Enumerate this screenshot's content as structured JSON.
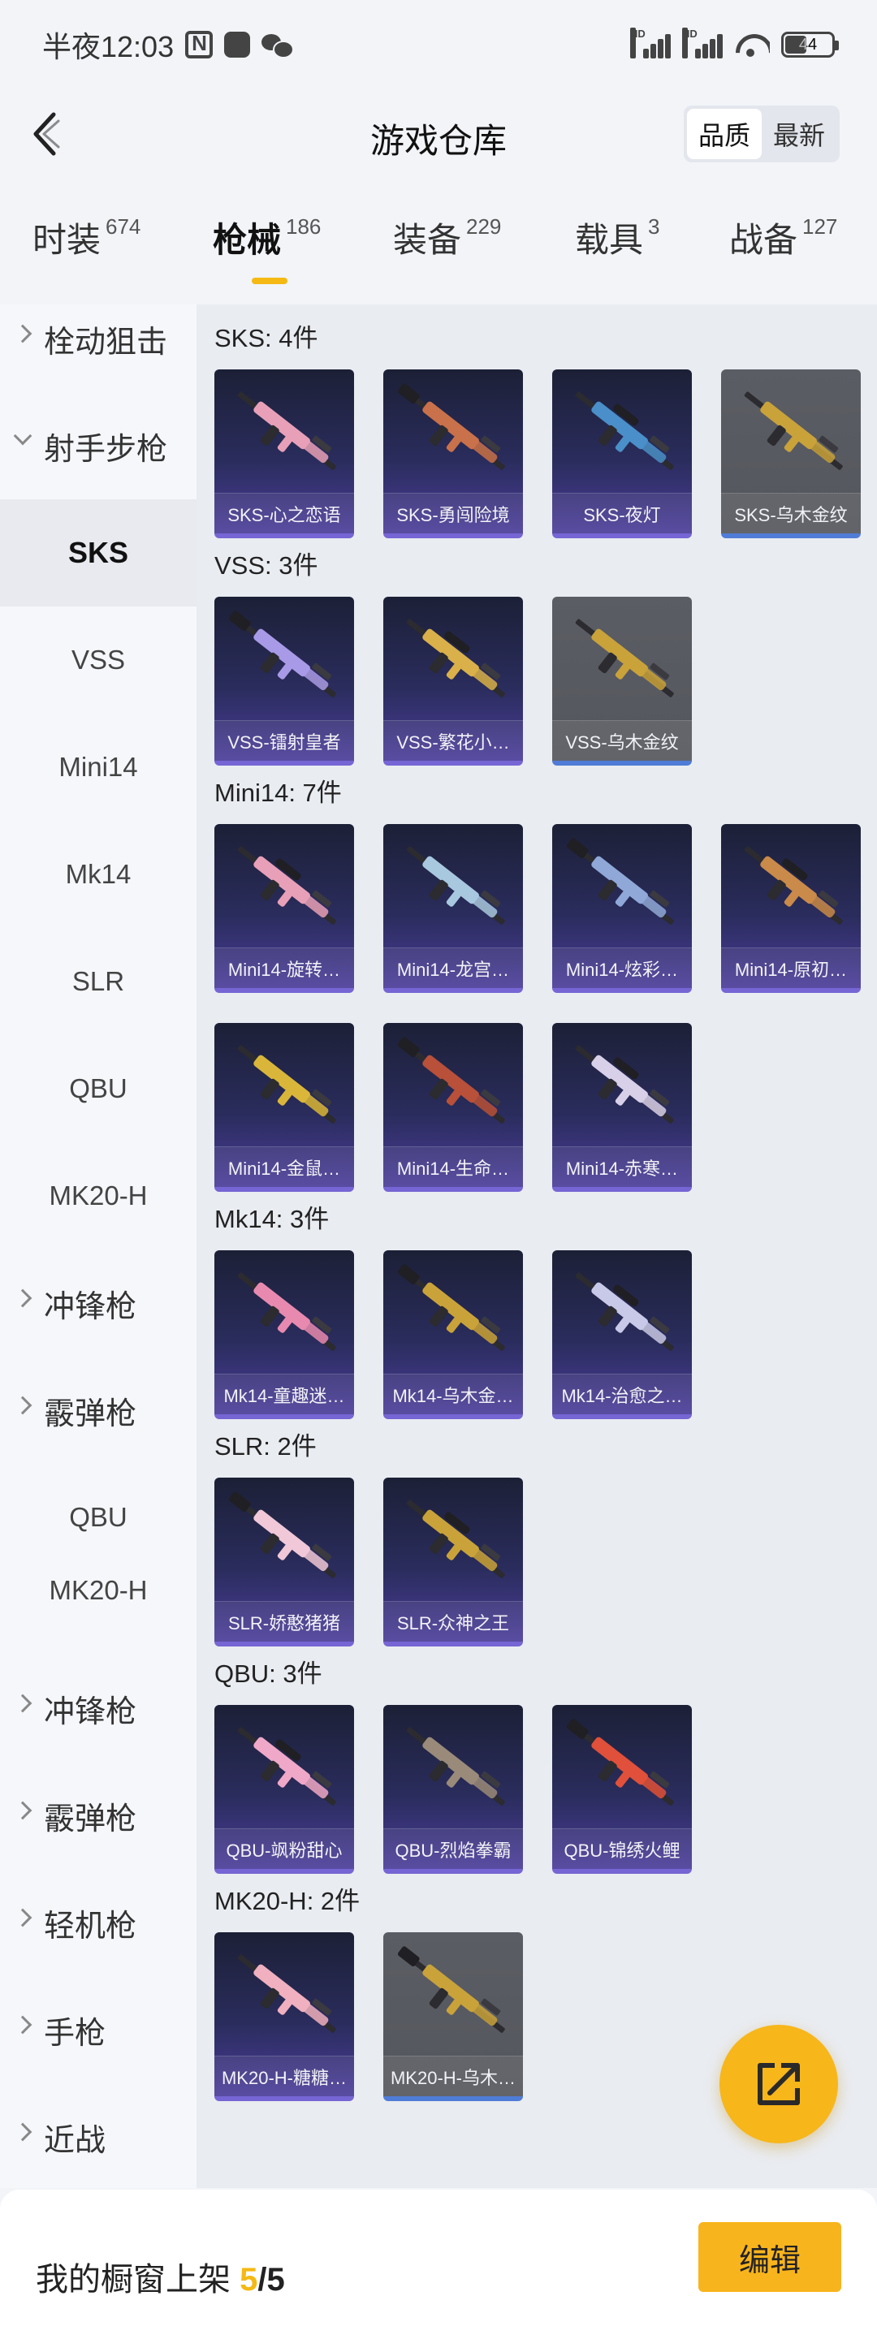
{
  "status_bar": {
    "time": "半夜12:03",
    "battery": "44",
    "battery_fraction": 0.44,
    "signal_badge": "HD"
  },
  "header": {
    "title": "游戏仓库",
    "sort_options": [
      "品质",
      "最新"
    ],
    "sort_active": "品质"
  },
  "tabs": [
    {
      "label": "时装",
      "count": "674"
    },
    {
      "label": "枪械",
      "count": "186",
      "active": true
    },
    {
      "label": "装备",
      "count": "229"
    },
    {
      "label": "载具",
      "count": "3"
    },
    {
      "label": "战备",
      "count": "127"
    }
  ],
  "sidebar": {
    "items": [
      {
        "label": "栓动狙击",
        "type": "group",
        "state": "collapsed"
      },
      {
        "label": "射手步枪",
        "type": "group",
        "state": "expanded"
      },
      {
        "label": "SKS",
        "type": "sub",
        "active": true
      },
      {
        "label": "VSS",
        "type": "sub"
      },
      {
        "label": "Mini14",
        "type": "sub"
      },
      {
        "label": "Mk14",
        "type": "sub"
      },
      {
        "label": "SLR",
        "type": "sub"
      },
      {
        "label": "QBU",
        "type": "sub"
      },
      {
        "label": "MK20-H",
        "type": "sub"
      },
      {
        "label": "冲锋枪",
        "type": "group",
        "state": "collapsed"
      },
      {
        "label": "霰弹枪",
        "type": "group",
        "state": "collapsed"
      },
      {
        "label": "QBU",
        "type": "sub"
      },
      {
        "label": "MK20-H",
        "type": "sub"
      },
      {
        "label": "冲锋枪",
        "type": "group",
        "state": "collapsed"
      },
      {
        "label": "霰弹枪",
        "type": "group",
        "state": "collapsed"
      },
      {
        "label": "轻机枪",
        "type": "group",
        "state": "collapsed"
      },
      {
        "label": "手枪",
        "type": "group",
        "state": "collapsed"
      },
      {
        "label": "近战",
        "type": "group",
        "state": "collapsed"
      }
    ]
  },
  "sections": [
    {
      "title": "SKS: 4件",
      "items": [
        {
          "name": "SKS-心之恋语",
          "rarity": "purple",
          "tint": "#e8a0b8"
        },
        {
          "name": "SKS-勇闯险境",
          "rarity": "purple",
          "tint": "#c9714a"
        },
        {
          "name": "SKS-夜灯",
          "rarity": "purple",
          "tint": "#4a8fc9"
        },
        {
          "name": "SKS-乌木金纹",
          "rarity": "gray",
          "tint": "#c9a23a"
        }
      ]
    },
    {
      "title": "VSS: 3件",
      "items": [
        {
          "name": "VSS-镭射皇者",
          "rarity": "purple",
          "tint": "#a99ae8"
        },
        {
          "name": "VSS-繁花小…",
          "rarity": "purple",
          "tint": "#d9b04a"
        },
        {
          "name": "VSS-乌木金纹",
          "rarity": "gray",
          "tint": "#c9a23a"
        }
      ]
    },
    {
      "title": "Mini14: 7件",
      "items": [
        {
          "name": "Mini14-旋转…",
          "rarity": "purple",
          "tint": "#e8a0b8"
        },
        {
          "name": "Mini14-龙宫…",
          "rarity": "purple",
          "tint": "#a8c8e0"
        },
        {
          "name": "Mini14-炫彩…",
          "rarity": "purple",
          "tint": "#8fa8d8"
        },
        {
          "name": "Mini14-原初…",
          "rarity": "purple",
          "tint": "#c98a4a"
        },
        {
          "name": "Mini14-金鼠…",
          "rarity": "purple",
          "tint": "#d9b63a"
        },
        {
          "name": "Mini14-生命…",
          "rarity": "purple",
          "tint": "#b8503a"
        },
        {
          "name": "Mini14-赤寒…",
          "rarity": "purple",
          "tint": "#d8d0e8"
        }
      ]
    },
    {
      "title": "Mk14: 3件",
      "items": [
        {
          "name": "Mk14-童趣迷…",
          "rarity": "purple",
          "tint": "#e88ab0"
        },
        {
          "name": "Mk14-乌木金…",
          "rarity": "purple",
          "tint": "#c9a23a"
        },
        {
          "name": "Mk14-治愈之…",
          "rarity": "purple",
          "tint": "#c8c8e8"
        }
      ]
    },
    {
      "title": "SLR: 2件",
      "items": [
        {
          "name": "SLR-娇憨猪猪",
          "rarity": "purple",
          "tint": "#f0c8d8"
        },
        {
          "name": "SLR-众神之王",
          "rarity": "purple",
          "tint": "#c9a23a"
        }
      ]
    },
    {
      "title": "QBU: 3件",
      "items": [
        {
          "name": "QBU-飒粉甜心",
          "rarity": "purple",
          "tint": "#f0a8c8"
        },
        {
          "name": "QBU-烈焰拳霸",
          "rarity": "purple",
          "tint": "#9a8a7a"
        },
        {
          "name": "QBU-锦绣火鲤",
          "rarity": "purple",
          "tint": "#e0503a"
        }
      ]
    },
    {
      "title": "MK20-H: 2件",
      "items": [
        {
          "name": "MK20-H-糖糖…",
          "rarity": "purple",
          "tint": "#f0b0c0"
        },
        {
          "name": "MK20-H-乌木…",
          "rarity": "gray",
          "tint": "#c9a23a"
        }
      ]
    }
  ],
  "bottom": {
    "label": "我的橱窗上架",
    "current": "5",
    "separator": "/",
    "total": "5",
    "edit_label": "编辑"
  },
  "colors": {
    "accent": "#f5b914",
    "purple_rarity": "#7665d4",
    "gray_rarity_bar": "#4f7cd6"
  }
}
